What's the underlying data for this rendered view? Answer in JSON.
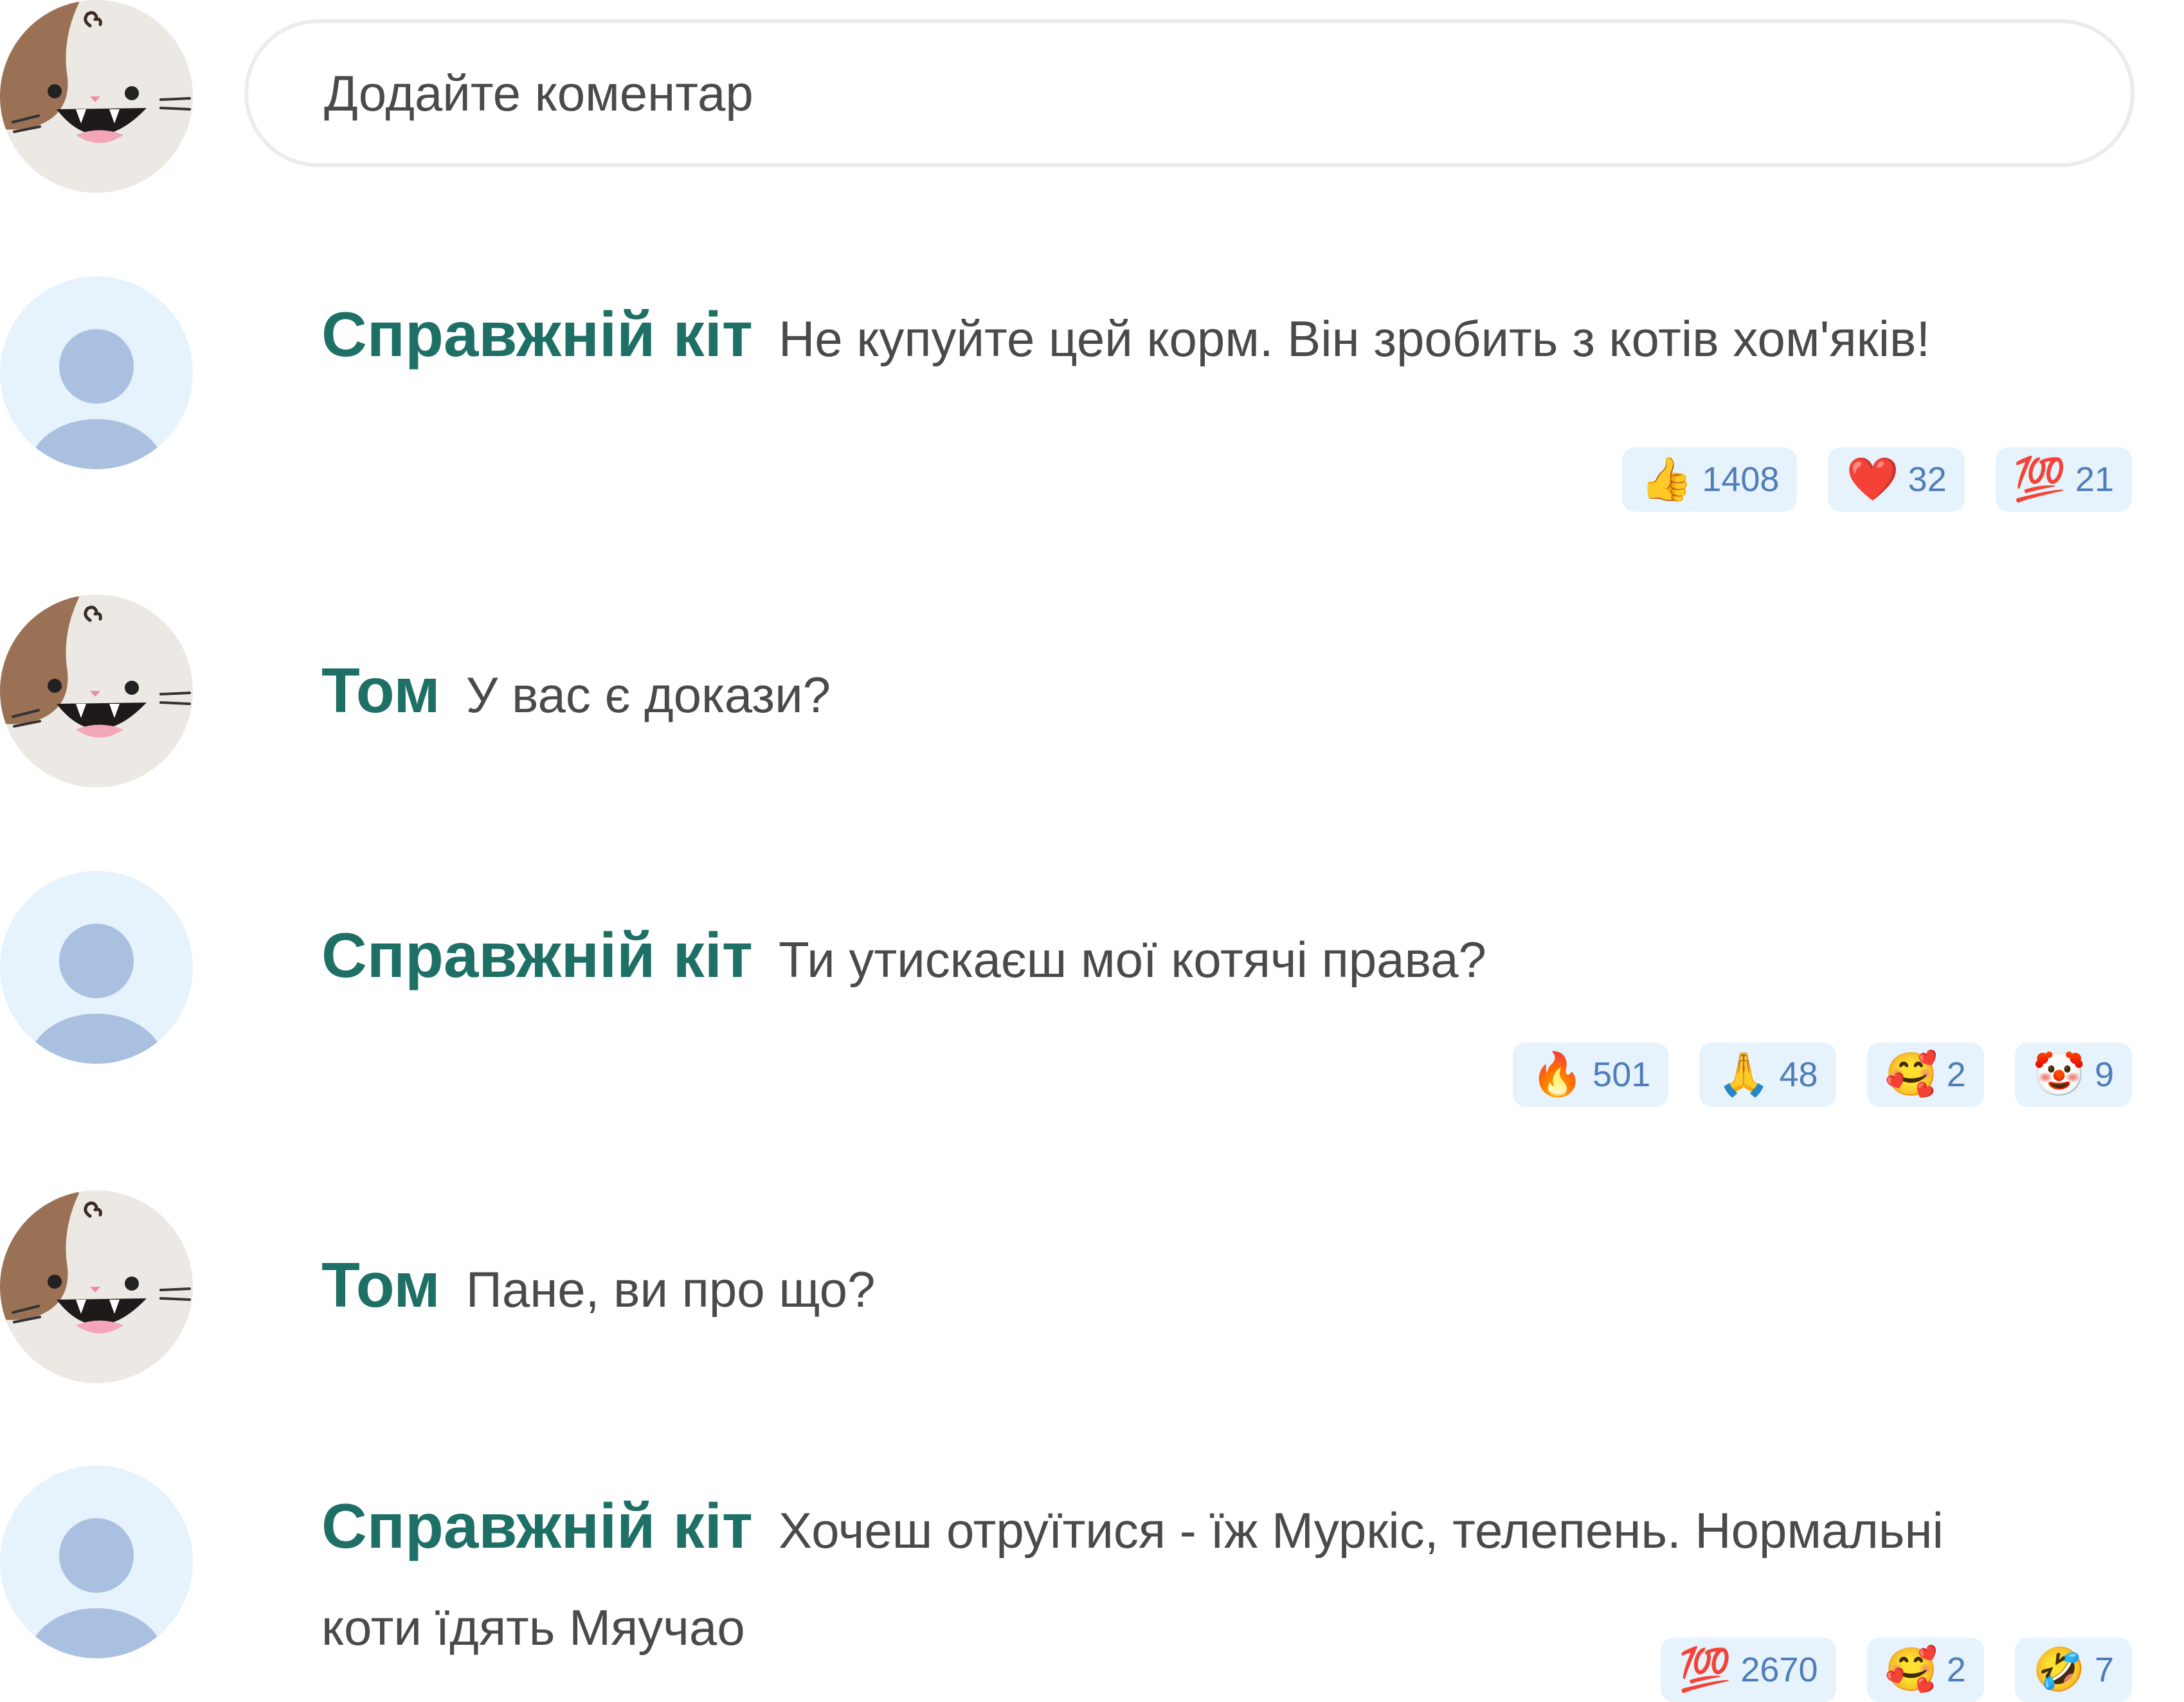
{
  "composer": {
    "placeholder": "Додайте коментар"
  },
  "comments": [
    {
      "author": "Справжній кіт",
      "text": "Не купуйте цей корм. Він зробить з котів хом'яків!",
      "reactions": [
        {
          "emoji": "👍",
          "icon": "thumbs-up-icon",
          "count": "1408"
        },
        {
          "emoji": "❤️",
          "icon": "heart-icon",
          "count": "32"
        },
        {
          "emoji": "💯",
          "icon": "hundred-points-icon",
          "count": "21"
        }
      ]
    },
    {
      "author": "Том",
      "text": "У вас є докази?",
      "reactions": []
    },
    {
      "author": "Справжній кіт",
      "text": "Ти утискаєш мої котячі права?",
      "reactions": [
        {
          "emoji": "🔥",
          "icon": "fire-icon",
          "count": "501"
        },
        {
          "emoji": "🙏",
          "icon": "folded-hands-icon",
          "count": "48"
        },
        {
          "emoji": "🥰",
          "icon": "smiling-face-hearts-icon",
          "count": "2"
        },
        {
          "emoji": "🤡",
          "icon": "clown-face-icon",
          "count": "9"
        }
      ]
    },
    {
      "author": "Том",
      "text": "Пане, ви про що?",
      "reactions": []
    },
    {
      "author": "Справжній кіт",
      "text": "Хочеш отруїтися - їж Муркіс, телепень. Нормальні коти їдять Мяучао",
      "reactions": [
        {
          "emoji": "💯",
          "icon": "hundred-points-icon",
          "count": "2670"
        },
        {
          "emoji": "🥰",
          "icon": "smiling-face-hearts-icon",
          "count": "2"
        },
        {
          "emoji": "🤣",
          "icon": "rolling-laughing-icon",
          "count": "7"
        }
      ]
    }
  ],
  "colors": {
    "author": "#1e6f66",
    "text": "#4a4a4a",
    "reaction_bg": "#e6f2fc",
    "reaction_count": "#4e7db7",
    "default_avatar_bg": "#e6f2fc",
    "default_avatar_figure": "#a9c0e0"
  }
}
